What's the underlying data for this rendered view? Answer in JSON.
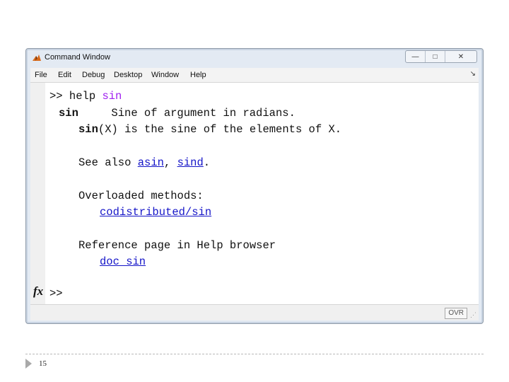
{
  "window": {
    "title": "Command Window",
    "controls": {
      "minimize": "—",
      "restore": "□",
      "close": "✕"
    }
  },
  "menu": {
    "items": [
      "File",
      "Edit",
      "Debug",
      "Desktop",
      "Window",
      "Help"
    ],
    "overflow_arrow": "↘"
  },
  "console": {
    "prompt_symbol": ">>",
    "command_word": "help",
    "command_arg": "sin",
    "help_name": "sin",
    "help_summary": "Sine of argument in radians.",
    "usage_fn": "sin",
    "usage_rest": "(X) is the sine of the elements of X.",
    "see_also_label": "See also",
    "see_also_links": [
      "asin",
      "sind"
    ],
    "see_also_sep": ",",
    "see_also_end": ".",
    "overloaded_label": "Overloaded methods:",
    "overloaded_link": "codistributed/sin",
    "reference_label": "Reference page in Help browser",
    "reference_link": "doc sin",
    "fx_label": "fx",
    "final_prompt": ">>"
  },
  "status": {
    "mode": "OVR"
  },
  "slide": {
    "page_number": "15"
  },
  "colors": {
    "keyword": "#a020f0",
    "link": "#1515c8"
  }
}
